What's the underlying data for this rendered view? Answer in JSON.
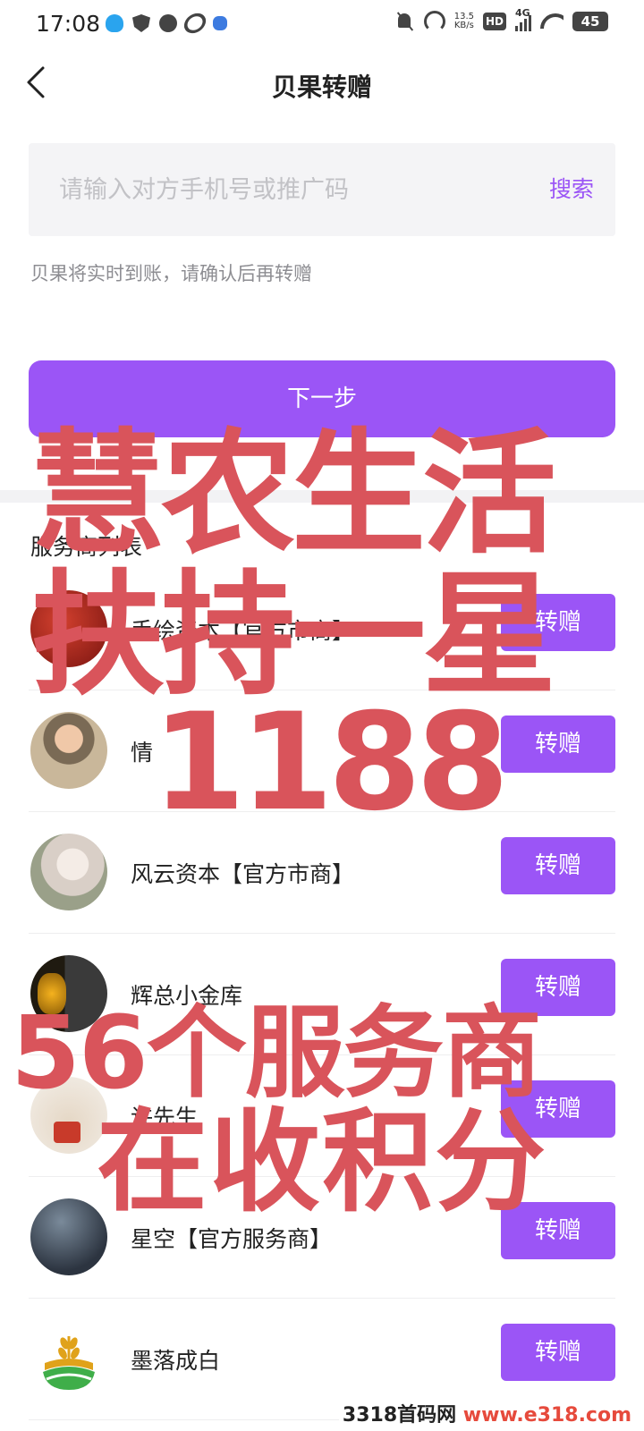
{
  "status_bar": {
    "time": "17:08",
    "net_speed_value": "13.5",
    "net_speed_unit": "KB/s",
    "hd": "HD",
    "network": "4G",
    "battery": "45"
  },
  "header": {
    "title": "贝果转赠"
  },
  "search": {
    "placeholder": "请输入对方手机号或推广码",
    "button_label": "搜索"
  },
  "hint": "贝果将实时到账，请确认后再转赠",
  "next_button_label": "下一步",
  "section_title": "服务商列表",
  "providers": [
    {
      "name": "手绘资本【官方市商】",
      "button_label": "转赠"
    },
    {
      "name": "情",
      "button_label": "转赠"
    },
    {
      "name": "风云资本【官方市商】",
      "button_label": "转赠"
    },
    {
      "name": "辉总小金库",
      "button_label": "转赠"
    },
    {
      "name": "许先生",
      "button_label": "转赠"
    },
    {
      "name": "星空【官方服务商】",
      "button_label": "转赠"
    },
    {
      "name": "墨落成白",
      "button_label": "转赠"
    }
  ],
  "overlay_text": {
    "line1": "慧农生活",
    "line2": "扶持一星",
    "line3": "1188",
    "line4": "56个服务商",
    "line5": "在收积分"
  },
  "watermark": {
    "site": "3318首码网",
    "url": "www.e318.com"
  },
  "colors": {
    "accent": "#9b55f6",
    "overlay_red": "#d9545b"
  }
}
